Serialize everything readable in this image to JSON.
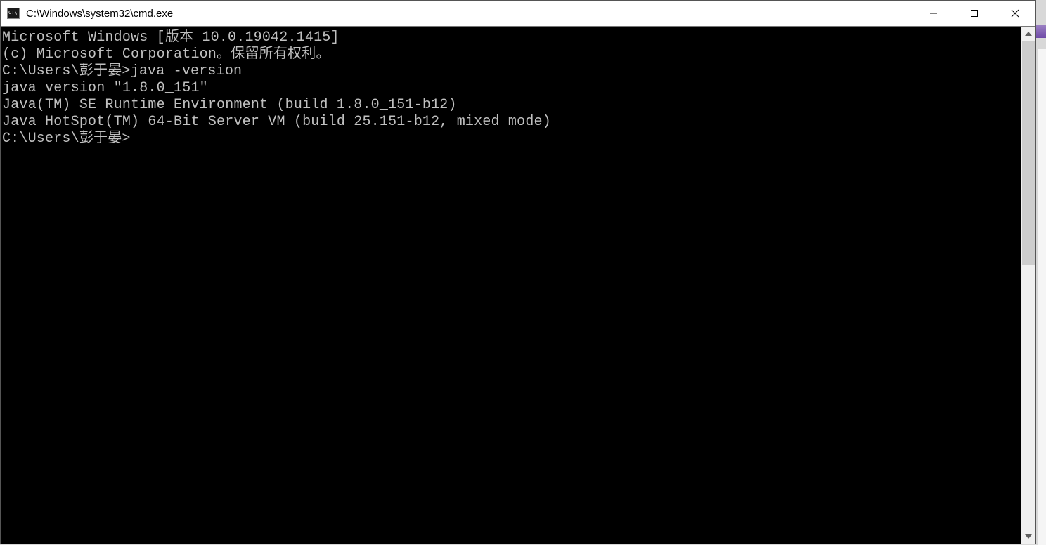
{
  "window": {
    "title": "C:\\Windows\\system32\\cmd.exe"
  },
  "terminal": {
    "lines": [
      "Microsoft Windows [版本 10.0.19042.1415]",
      "(c) Microsoft Corporation。保留所有权利。",
      "",
      "C:\\Users\\彭于晏>java -version",
      "java version \"1.8.0_151\"",
      "Java(TM) SE Runtime Environment (build 1.8.0_151-b12)",
      "Java HotSpot(TM) 64-Bit Server VM (build 25.151-b12, mixed mode)",
      "",
      "C:\\Users\\彭于晏>"
    ]
  }
}
